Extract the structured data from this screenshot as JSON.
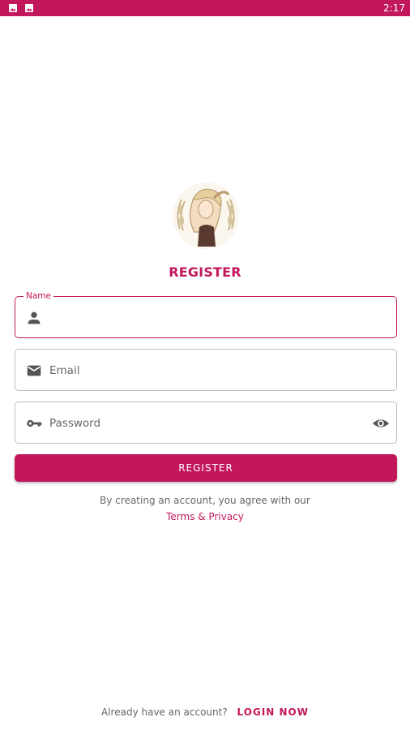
{
  "status_bar": {
    "time": "2:17",
    "notification_icons": [
      "image-icon",
      "image-icon"
    ],
    "color": "#c2185b"
  },
  "header": {
    "title": "REGISTER"
  },
  "form": {
    "name": {
      "label": "Name",
      "value": "",
      "icon": "person-icon"
    },
    "email": {
      "placeholder": "Email",
      "icon": "email-icon"
    },
    "password": {
      "placeholder": "Password",
      "icon": "key-icon",
      "trailing_icon": "eye-icon"
    },
    "submit_label": "REGISTER"
  },
  "agreement": {
    "text": "By creating an account, you agree with our",
    "link": "Terms & Privacy"
  },
  "footer": {
    "prompt": "Already have an account?",
    "login_link": "LOGIN NOW"
  },
  "colors": {
    "accent": "#c2185b",
    "border": "#bdbdbd",
    "icon": "#555555"
  }
}
